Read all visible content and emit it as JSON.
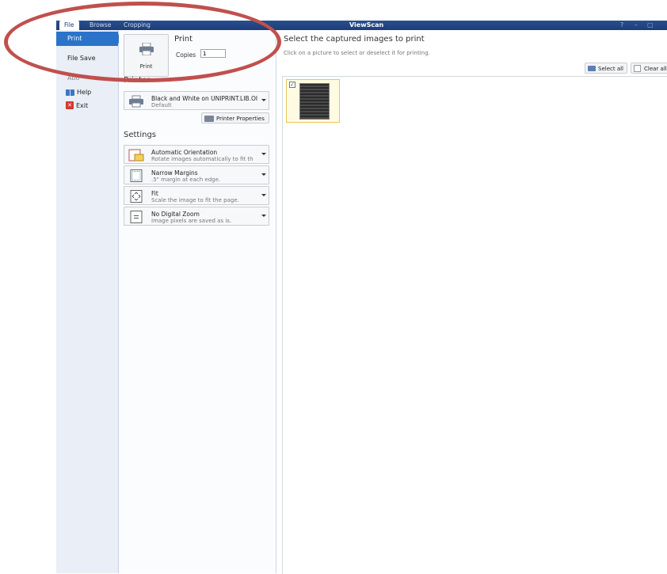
{
  "tabs": {
    "file": "File",
    "browse": "Browse",
    "cropping": "Cropping"
  },
  "app_title": "ViewScan",
  "window_controls": {
    "help": "?",
    "minimize": "–",
    "restore": "▢"
  },
  "leftnav": {
    "print": "Print",
    "file_save": "File Save",
    "about": "Abo",
    "help": "Help",
    "exit": "Exit"
  },
  "print_section": {
    "button_label": "Print",
    "heading": "Print",
    "copies_label": "Copies",
    "copies_value": "1"
  },
  "printer_section": {
    "heading": "Printer",
    "printer_name": "Black and White on UNIPRINT.LIB.OI",
    "printer_status": "Default",
    "properties_button": "Printer Properties"
  },
  "settings_section": {
    "heading": "Settings",
    "items": [
      {
        "title": "Automatic Orientation",
        "desc": "Rotate images automatically to fit th"
      },
      {
        "title": "Narrow Margins",
        "desc": ".5\" margin at each edge."
      },
      {
        "title": "Fit",
        "desc": "Scale the image to fit the page."
      },
      {
        "title": "No Digital Zoom",
        "desc": "Image pixels are saved as is."
      }
    ]
  },
  "right_pane": {
    "heading": "Select the captured images to print",
    "subtitle": "Click on a picture to select or deselect it for printing.",
    "select_all": "Select all",
    "clear_all": "Clear all",
    "thumbnail_checked": "✓"
  },
  "colors": {
    "accent": "#2b73c9",
    "titlebar": "#1c3e78",
    "annotation": "#c0504d"
  }
}
